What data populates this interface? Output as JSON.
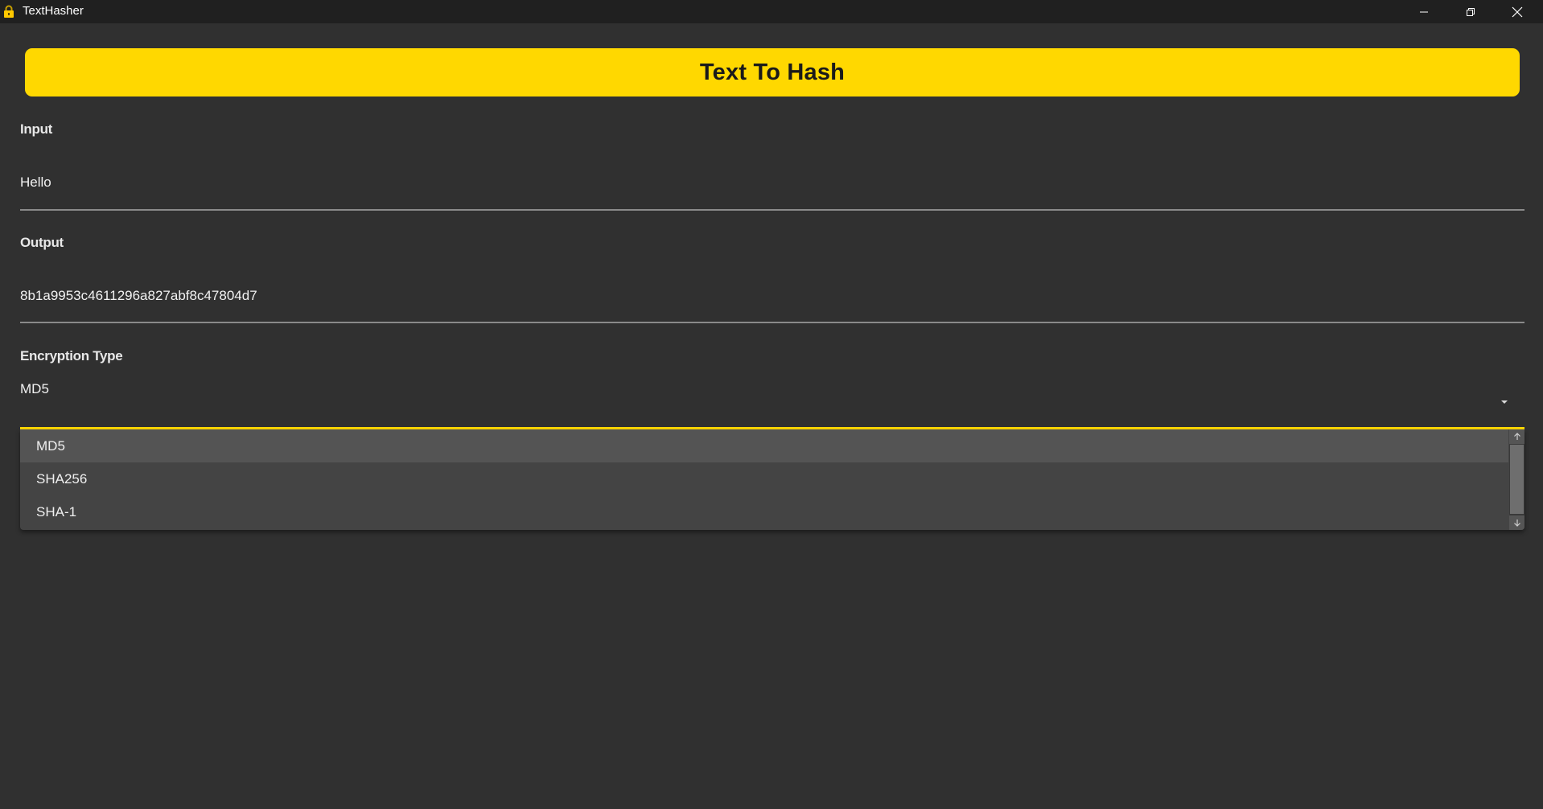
{
  "window": {
    "title": "TextHasher",
    "app_icon": "padlock-icon",
    "controls": [
      "minimize-icon",
      "restore-icon",
      "close-icon"
    ]
  },
  "header": {
    "title": "Text To Hash",
    "background_color": "#ffd800"
  },
  "input_field": {
    "label": "Input",
    "value": "Hello"
  },
  "output_field": {
    "label": "Output",
    "value": "8b1a9953c4611296a827abf8c47804d7"
  },
  "encryption_type": {
    "label": "Encryption Type",
    "selected": "MD5",
    "dropdown_icon": "caret-down-icon",
    "focus_color": "#ffd800",
    "options": [
      "MD5",
      "SHA256",
      "SHA-1"
    ],
    "scrollbar": {
      "up_icon": "arrow-up-icon",
      "down_icon": "arrow-down-icon"
    }
  }
}
